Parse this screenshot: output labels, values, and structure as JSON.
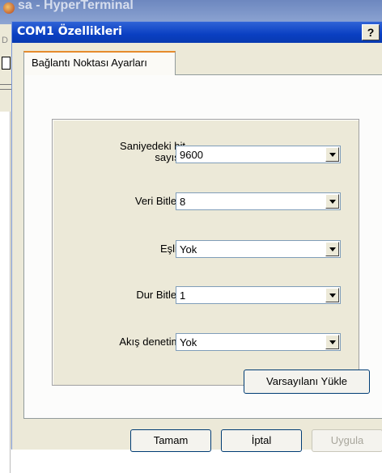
{
  "background_window": {
    "title": "sa - HyperTerminal",
    "menu_letter": "D"
  },
  "dialog": {
    "title": "COM1 Özellikleri",
    "help_label": "?",
    "tab_label": "Bağlantı Noktası Ayarları",
    "fields": [
      {
        "label_line1": "Saniyedeki bit",
        "label_line2": "sayısı:",
        "value": "9600"
      },
      {
        "label": "Veri Bitleri:",
        "value": "8"
      },
      {
        "label": "Eşlik:",
        "value": "Yok"
      },
      {
        "label": "Dur Bitleri:",
        "value": "1"
      },
      {
        "label": "Akış denetimi:",
        "value": "Yok"
      }
    ],
    "defaults_button": "Varsayılanı Yükle",
    "ok_button": "Tamam",
    "cancel_button": "İptal",
    "apply_button": "Uygula"
  }
}
